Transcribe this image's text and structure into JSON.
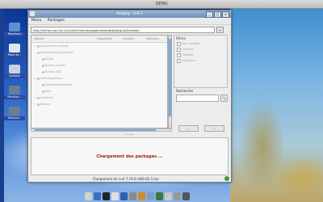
{
  "outer_window": {
    "title": "QEMU"
  },
  "desktop": {
    "icons": [
      {
        "label": "Répertoire",
        "color": "#5d8fd6"
      },
      {
        "label": "Poste de...",
        "color": "#dfe6ee"
      },
      {
        "label": "Corbeille",
        "color": "#c9d3db"
      },
      {
        "label": "Persistan...",
        "color": "#6c7d93"
      },
      {
        "label": "Sessions...",
        "color": "#6c7d93"
      }
    ]
  },
  "app": {
    "title": "Netpkg - 4.6.3",
    "menu": [
      "Menu",
      "Packages"
    ],
    "url": "http://mirrors.cdn.llm.univ-lille.fr/ubuntu/pool/mdnet/dists/pkgs.bz2/mdnet/",
    "tree_columns": [
      "Paquet",
      "Disponible",
      "Installée",
      "Sélection"
    ],
    "tree_items": [
      {
        "label": "Applications console",
        "expander": "+"
      },
      {
        "label": "Applications graphiques",
        "expander": "–"
      },
      {
        "label": "Audio",
        "expander": ""
      },
      {
        "label": "Bureau Gnome",
        "expander": ""
      },
      {
        "label": "Bureau KDE",
        "expander": ""
      },
      {
        "label": "Développement",
        "expander": "+"
      },
      {
        "label": "Internationalisation",
        "expander": ""
      },
      {
        "label": "Jeux",
        "expander": ""
      },
      {
        "label": "Librairies",
        "expander": "+"
      },
      {
        "label": "Réseau",
        "expander": "+"
      }
    ],
    "filters": {
      "title": "Filtres",
      "options": [
        "Non installés",
        "Installés",
        "Modifiés",
        "Orphelins"
      ]
    },
    "search": {
      "title": "Recherche",
      "button": "🔍"
    },
    "divider": "•••••",
    "loading_message": "Chargement des packages ...",
    "status_text": "Chargement de curl-7.19.6-i486-62.1.txz"
  },
  "dock": {
    "items": [
      "#d0d0d0",
      "#3c6fc0",
      "#222222",
      "#e0e0e0",
      "#2b5fb0",
      "#8a8a8a",
      "#d08a2a",
      "#7e9fc4",
      "#3a7a3a",
      "#c9c9c9",
      "#999999",
      "#555555"
    ]
  }
}
